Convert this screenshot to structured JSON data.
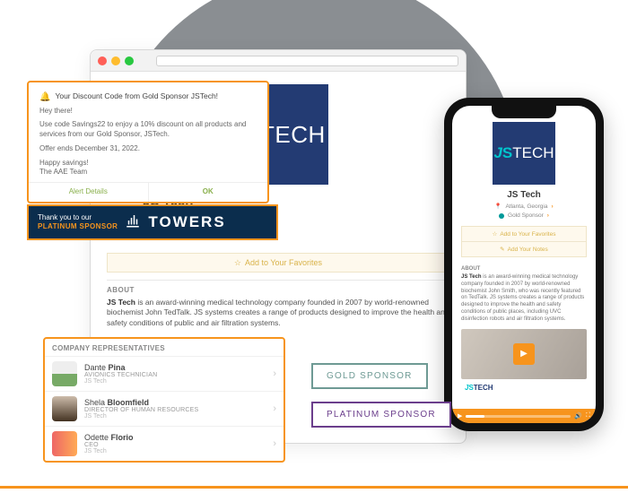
{
  "company": {
    "name": "JS Tech",
    "location": "Atlanta, Georgia",
    "sponsor_tier": "Gold Sponsor",
    "about_label": "ABOUT",
    "about_html_desktop_prefix": "JS Tech",
    "about_desktop": " is an award-winning medical technology company founded in 2007 by world-renowned biochemist John TedTalk. JS systems creates a range of products designed to improve the health and safety conditions of public and air filtration systems.",
    "about_phone": " is an award-winning medical technology company founded in 2007 by world-renowned biochemist John Smith, who was recently featured on TedTalk. JS systems creates a range of products designed to improve the health and safety conditions of public places, including UVC disinfection robots and air filtration systems."
  },
  "actions": {
    "add_favorites": "Add to Your Favorites",
    "add_notes": "Add Your Notes"
  },
  "popup": {
    "title": "Your Discount Code from Gold Sponsor JSTech!",
    "greeting": "Hey there!",
    "body": "Use code Savings22 to enjoy a 10% discount on all products and services from our Gold Sponsor, JSTech.",
    "expiry": "Offer ends December 31, 2022.",
    "signoff1": "Happy savings!",
    "signoff2": "The AAE Team",
    "btn_left": "Alert Details",
    "btn_right": "OK"
  },
  "towers": {
    "line1": "Thank you to our",
    "line2": "PLATINUM SPONSOR",
    "brand": "TOWERS"
  },
  "reps": {
    "header": "COMPANY REPRESENTATIVES",
    "list": [
      {
        "first": "Dante",
        "last": "Pina",
        "role": "AVIONICS TECHNICIAN",
        "company": "JS Tech"
      },
      {
        "first": "Shela",
        "last": "Bloomfield",
        "role": "DIRECTOR OF HUMAN RESOURCES",
        "company": "JS Tech"
      },
      {
        "first": "Odette",
        "last": "Florio",
        "role": "CEO",
        "company": "JS Tech"
      }
    ]
  },
  "badges": {
    "gold": "GOLD SPONSOR",
    "platinum": "PLATINUM SPONSOR"
  }
}
